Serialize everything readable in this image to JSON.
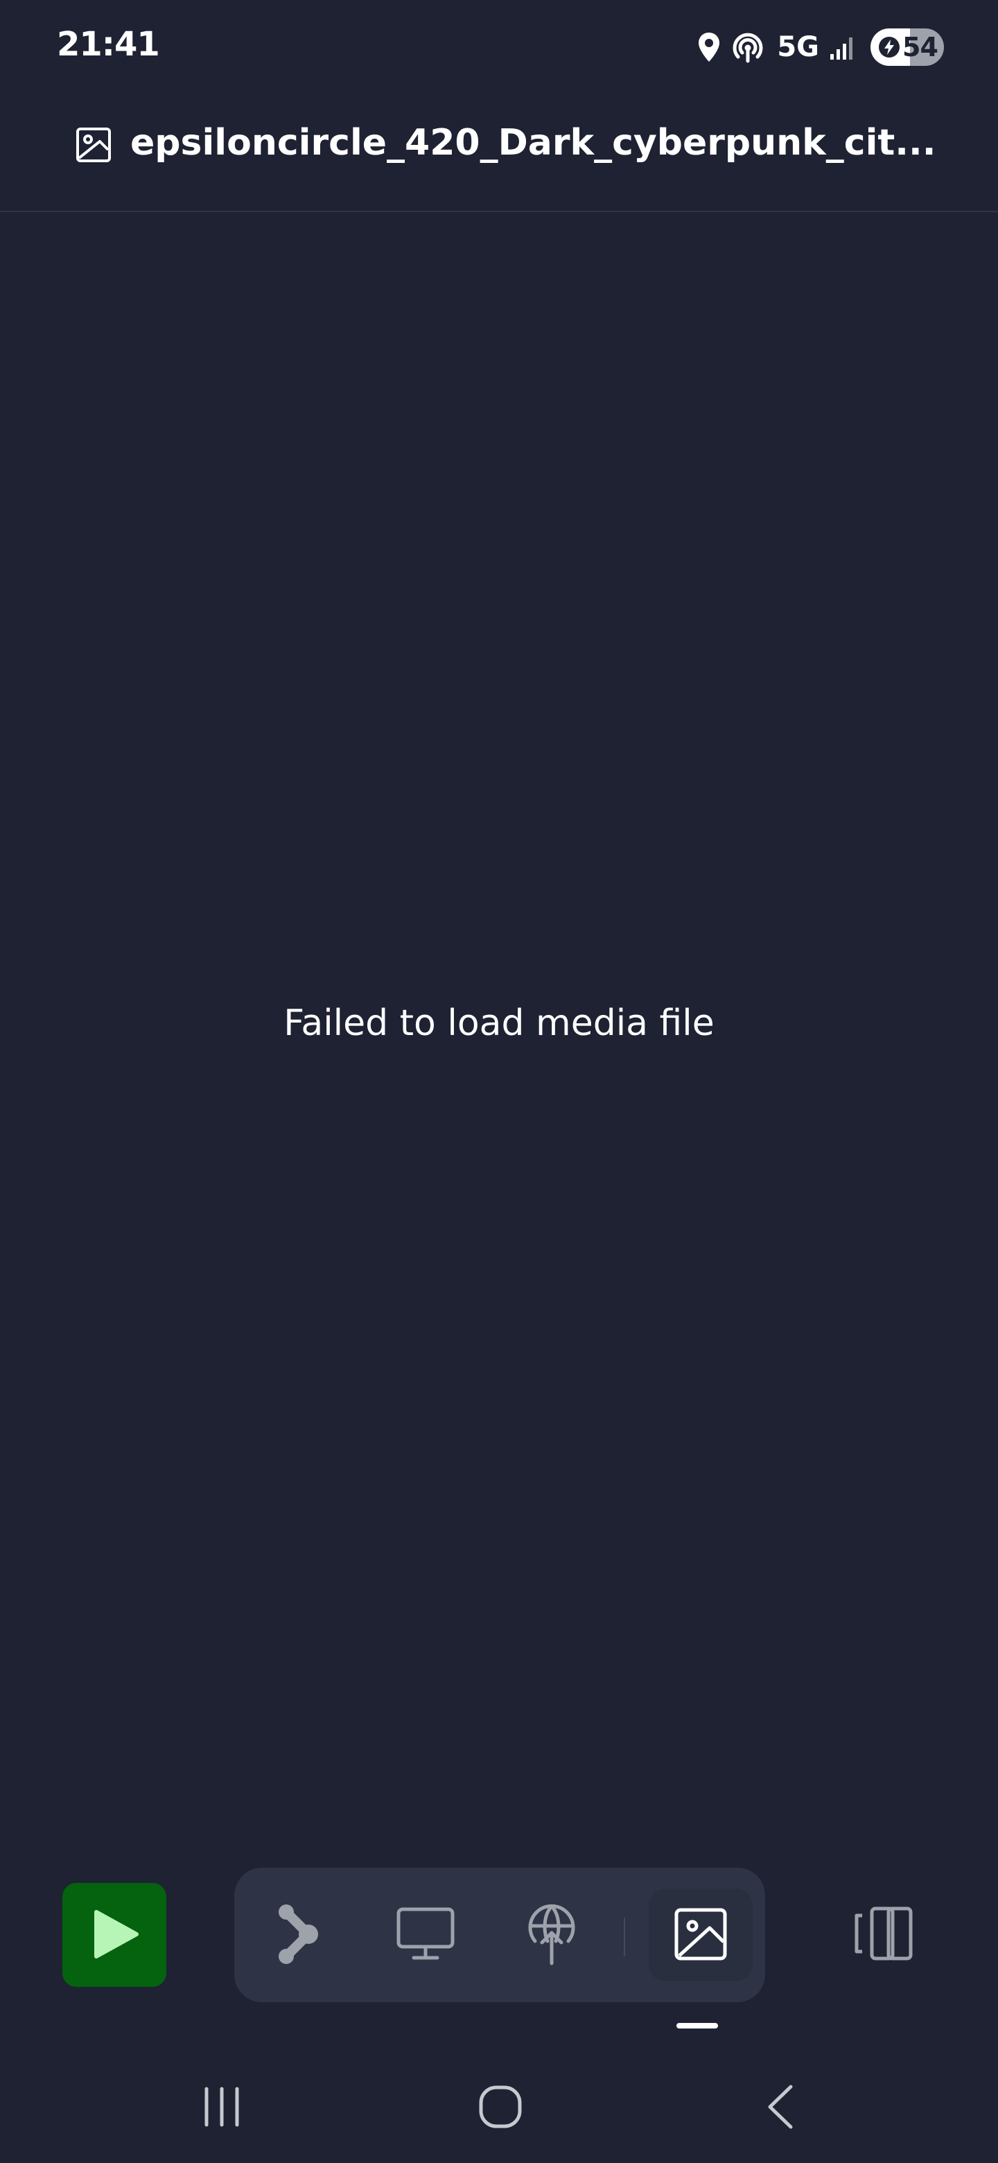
{
  "status_bar": {
    "time": "21:41",
    "network": "5G",
    "battery_level": "54",
    "battery_fraction": 0.54,
    "icons": [
      "location-icon",
      "hotspot-icon",
      "signal-icon",
      "battery-charging-icon"
    ]
  },
  "title_bar": {
    "title": "epsiloncircle_420_Dark_cyberpunk_cit...",
    "icon": "image-icon"
  },
  "main": {
    "error_message": "Failed to load media file"
  },
  "toolbar": {
    "play_icon": "play-icon",
    "dock_items": [
      {
        "name": "graph-icon",
        "active": false
      },
      {
        "name": "desktop-icon",
        "active": false
      },
      {
        "name": "globe-upload-icon",
        "active": false
      },
      {
        "name": "image-icon",
        "active": true
      }
    ],
    "cast_icon": "cast-screen-icon"
  },
  "nav_bar": {
    "items": [
      "recents-icon",
      "home-icon",
      "back-icon"
    ]
  },
  "colors": {
    "background": "#1e2232",
    "dock_background": "#2e3346",
    "play_button": "#05620f",
    "play_icon": "#b7f5b7",
    "icon_muted": "#9ea2ab",
    "text": "#ffffff"
  }
}
